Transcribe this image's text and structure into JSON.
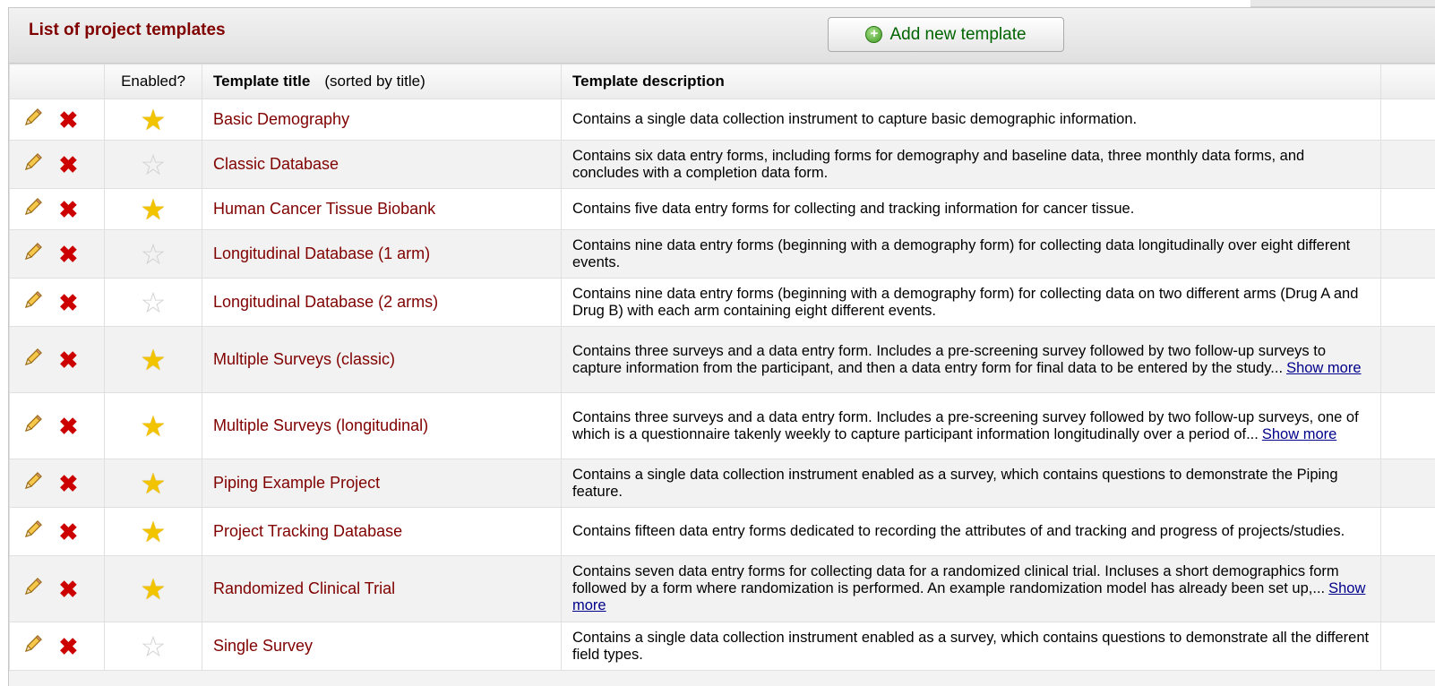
{
  "header": {
    "title": "List of project templates",
    "add_button_label": "Add new template"
  },
  "columns": {
    "enabled": "Enabled?",
    "title": "Template title",
    "title_sort_note": "(sorted by title)",
    "description": "Template description"
  },
  "icons": {
    "edit": "pencil-icon",
    "delete": "delete-x-icon",
    "enabled": "star-filled-icon",
    "disabled": "star-empty-icon",
    "add": "plus-circle-icon"
  },
  "colors": {
    "title_text": "#800000",
    "add_button_text": "#006400",
    "delete_icon": "#cc0000",
    "star_enabled": "#f2c400",
    "link": "#00008b"
  },
  "rows": [
    {
      "enabled": true,
      "title": "Basic Demography",
      "description": "Contains a single data collection instrument to capture basic demographic information.",
      "show_more": ""
    },
    {
      "enabled": false,
      "title": "Classic Database",
      "description": "Contains six data entry forms, including forms for demography and baseline data, three monthly data forms, and concludes with a completion data form.",
      "show_more": ""
    },
    {
      "enabled": true,
      "title": "Human Cancer Tissue Biobank",
      "description": "Contains five data entry forms for collecting and tracking information for cancer tissue.",
      "show_more": ""
    },
    {
      "enabled": false,
      "title": "Longitudinal Database (1 arm)",
      "description": "Contains nine data entry forms (beginning with a demography form) for collecting data longitudinally over eight different events.",
      "show_more": ""
    },
    {
      "enabled": false,
      "title": "Longitudinal Database (2 arms)",
      "description": "Contains nine data entry forms (beginning with a demography form) for collecting data on two different arms (Drug A and Drug B) with each arm containing eight different events.",
      "show_more": ""
    },
    {
      "enabled": true,
      "title": "Multiple Surveys (classic)",
      "description": "Contains three surveys and a data entry form. Includes a pre-screening survey followed by two follow-up surveys to capture information from the participant, and then a data entry form for final data to be entered by the study...",
      "show_more": "Show more"
    },
    {
      "enabled": true,
      "title": "Multiple Surveys (longitudinal)",
      "description": "Contains three surveys and a data entry form. Includes a pre-screening survey followed by two follow-up surveys, one of which is a questionnaire takenly weekly to capture participant information longitudinally over a period of...",
      "show_more": "Show more"
    },
    {
      "enabled": true,
      "title": "Piping Example Project",
      "description": "Contains a single data collection instrument enabled as a survey, which contains questions to demonstrate the Piping feature.",
      "show_more": ""
    },
    {
      "enabled": true,
      "title": "Project Tracking Database",
      "description": "Contains fifteen data entry forms dedicated to recording the attributes of and tracking and progress of projects/studies.",
      "show_more": ""
    },
    {
      "enabled": true,
      "title": "Randomized Clinical Trial",
      "description": "Contains seven data entry forms for collecting data for a randomized clinical trial. Incluses a short demographics form followed by a form where randomization is performed. An example randomization model has already been set up,...",
      "show_more": "Show more"
    },
    {
      "enabled": false,
      "title": "Single Survey",
      "description": "Contains a single data collection instrument enabled as a survey, which contains questions to demonstrate all the different field types.",
      "show_more": ""
    }
  ]
}
